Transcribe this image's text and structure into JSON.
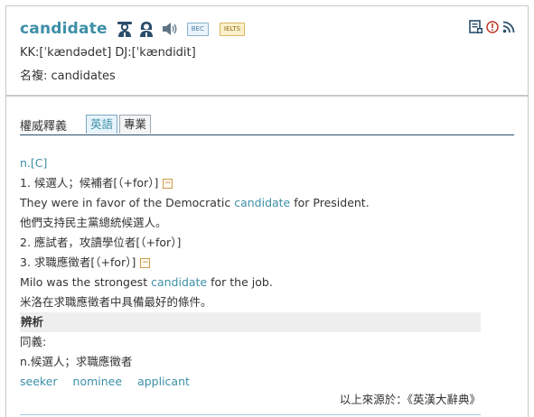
{
  "entry": {
    "headword": "candidate",
    "tags": {
      "bec": "BEC",
      "ielts": "IELTS"
    },
    "pronunciation": "KK:[ˈkændədet] DJ:[ˈkændidit]",
    "plural": "名複: candidates"
  },
  "tabs": {
    "main": "權威釋義",
    "english": "英語",
    "professional": "專業"
  },
  "definition": {
    "pos": "n.[C]",
    "sense1": "1. 候選人；候補者[（+for）]",
    "ex1_pre": "They were in favor of the Democratic ",
    "ex1_word": "candidate",
    "ex1_post": " for President.",
    "ex1_zh": "他們支持民主黨總統候選人。",
    "sense2": "2. 應試者，攻讀學位者[（+for）]",
    "sense3": "3. 求職應徵者[（+for）]",
    "ex3_pre": "Milo was the strongest ",
    "ex3_word": "candidate",
    "ex3_post": " for the job.",
    "ex3_zh": "米洛在求職應徵者中具備最好的條件。",
    "collapse_symbol": "−"
  },
  "analysis": {
    "heading": "辨析",
    "synonyms_label": "同義:",
    "synonyms_gloss": "n.候選人；求職應徵者",
    "synonyms": [
      "seeker",
      "nominee",
      "applicant"
    ]
  },
  "source": "以上來源於：《英漢大辭典》",
  "colors": {
    "accent": "#3d8fa8",
    "border": "#c9c9c9",
    "section_bg": "#eeeeee"
  },
  "icons": [
    "male-voice-icon",
    "female-voice-icon",
    "speaker-icon",
    "wordbook-add-icon",
    "report-error-icon",
    "rss-feed-icon"
  ]
}
